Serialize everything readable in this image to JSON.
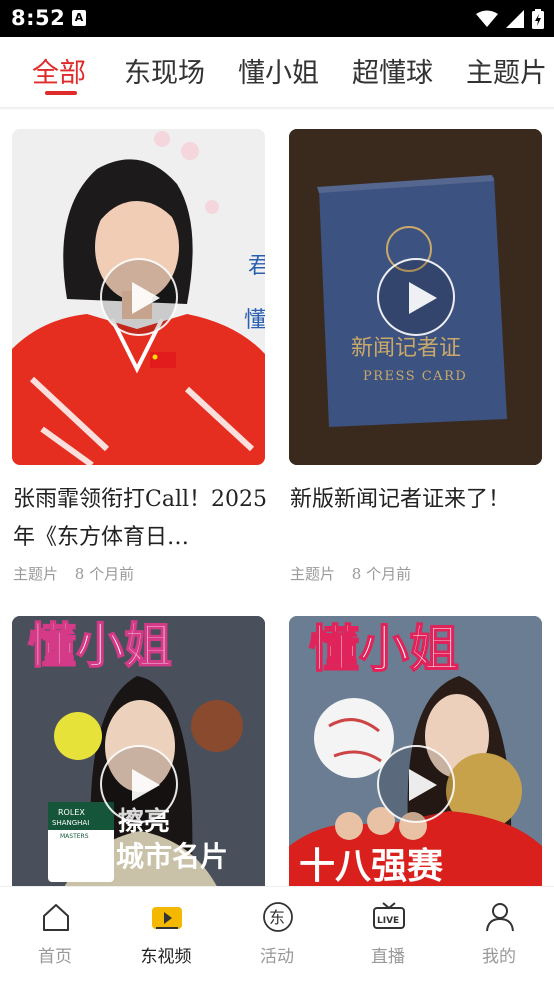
{
  "status_bar": {
    "time": "8:52",
    "notification_icon": "A"
  },
  "tabs": [
    {
      "label": "全部",
      "active": true
    },
    {
      "label": "东现场",
      "active": false
    },
    {
      "label": "懂小姐",
      "active": false
    },
    {
      "label": "超懂球",
      "active": false
    },
    {
      "label": "主题片",
      "active": false
    }
  ],
  "cards": [
    {
      "title": "张雨霏领衔打Call！2025年《东方体育日…",
      "category": "主题片",
      "time": "8 个月前"
    },
    {
      "title": "新版新闻记者证来了！",
      "category": "主题片",
      "time": "8 个月前"
    },
    {
      "thumb_text_top": "懂小姐",
      "thumb_text_line1": "擦亮",
      "thumb_text_line2": "城市名片",
      "badge_line1": "ROLEX",
      "badge_line2": "SHANGHAI",
      "badge_line3": "MASTERS"
    },
    {
      "thumb_text_top": "懂小姐",
      "thumb_text_line1": "十八强赛"
    }
  ],
  "card2_thumb": {
    "passport_title": "新闻记者证",
    "passport_subtitle": "PRESS CARD"
  },
  "bottom_nav": [
    {
      "label": "首页",
      "icon": "home-icon",
      "active": false
    },
    {
      "label": "东视频",
      "icon": "video-icon",
      "active": true
    },
    {
      "label": "活动",
      "icon": "activity-icon",
      "icon_char": "东",
      "active": false
    },
    {
      "label": "直播",
      "icon": "live-tv-icon",
      "icon_text": "LIVE",
      "active": false
    },
    {
      "label": "我的",
      "icon": "user-icon",
      "active": false
    }
  ],
  "colors": {
    "accent": "#e02b2b",
    "nav_active_icon": "#f5b800"
  }
}
